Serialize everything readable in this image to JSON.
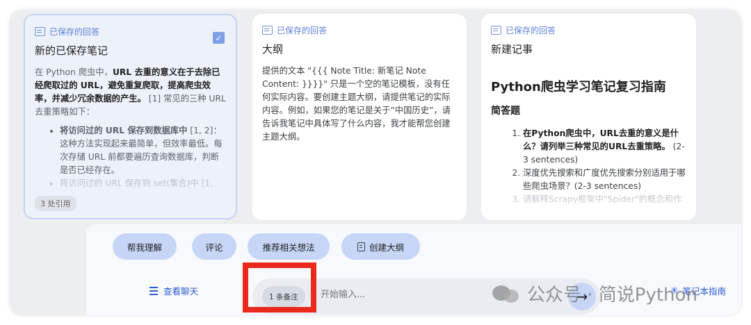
{
  "cards": [
    {
      "saved_label": "已保存的回答",
      "title": "新的已保存笔记",
      "checked": true,
      "para_prefix": "在 Python 爬虫中，",
      "para_bold": "URL 去重的意义在于去除已经爬取过的 URL，避免重复爬取，提高爬虫效率，并减少冗余数据的产生。",
      "para_suffix": " [1] 常见的三种 URL 去重策略如下：",
      "bullet1_bold": "将访问过的 URL 保存到数据库中",
      "bullet1_rest": " [1, 2]：这种方法实现起来最简单，但效率最低。每次存储 URL 前都要遍历查询数据库，判断是否已经存在。",
      "bullet2_faded": "将访问过的 URL 保存到 set(集合)中 [1,",
      "citations": "3 处引用"
    },
    {
      "saved_label": "已保存的回答",
      "title": "大纲",
      "body": "提供的文本 \"{{{ Note Title: 新笔记 Note Content: }}}}\" 只是一个空的笔记模板，没有任何实际内容。要创建主题大纲，请提供笔记的实际内容。例如，如果您的笔记是关于“中国历史”，请告诉我笔记中具体写了什么内容，我才能帮您创建主题大纲。"
    },
    {
      "saved_label": "已保存的回答",
      "title": "新建记事",
      "heading": "Python爬虫学习笔记复习指南",
      "subheading": "简答题",
      "items": [
        {
          "bold": "在Python爬虫中，URL去重的意义是什么？请列举三种常见的URL去重策略。",
          "rest": " (2-3 sentences)"
        },
        {
          "bold": "",
          "rest": "深度优先搜索和广度优先搜索分别适用于哪些爬虫场景？(2-3 sentences)"
        },
        {
          "bold": "",
          "rest": "请解释Scrapy框架中\"Spider\"的概念和作"
        }
      ]
    }
  ],
  "actions": {
    "help_understand": "帮我理解",
    "comment": "评论",
    "suggest_ideas": "推荐相关想法",
    "create_outline": "创建大纲"
  },
  "footer": {
    "view_chat": "查看聊天",
    "note_count": "1 条备注",
    "input_placeholder": "开始输入...",
    "notebook_guide": "笔记本指南"
  },
  "watermark": "公众号 · 简说Python",
  "colors": {
    "accent": "#2f5bd0",
    "chip": "#c7d5f6",
    "highlight": "#e8291c"
  }
}
